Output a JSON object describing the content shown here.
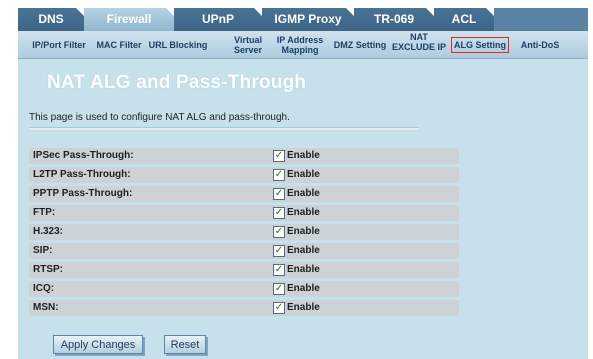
{
  "top_tabs": [
    {
      "label": "DNS",
      "active": false
    },
    {
      "label": "Firewall",
      "active": true
    },
    {
      "label": "UPnP",
      "active": false
    },
    {
      "label": "IGMP Proxy",
      "active": false
    },
    {
      "label": "TR-069",
      "active": false
    },
    {
      "label": "ACL",
      "active": false
    }
  ],
  "sub_nav": [
    {
      "label": "IP/Port Filter"
    },
    {
      "label": "MAC Filter"
    },
    {
      "label": "URL Blocking"
    },
    {
      "label": "Virtual Server"
    },
    {
      "label": "IP Address Mapping"
    },
    {
      "label": "DMZ Setting"
    },
    {
      "label": "NAT EXCLUDE IP"
    },
    {
      "label": "ALG Setting",
      "active": true
    },
    {
      "label": "Anti-DoS"
    }
  ],
  "page": {
    "title": "NAT ALG and Pass-Through",
    "description": "This page is used to configure NAT ALG and pass-through."
  },
  "options": [
    {
      "label": "IPSec Pass-Through:",
      "enabled": true,
      "enable_label": "Enable"
    },
    {
      "label": "L2TP Pass-Through:",
      "enabled": true,
      "enable_label": "Enable"
    },
    {
      "label": "PPTP Pass-Through:",
      "enabled": true,
      "enable_label": "Enable"
    },
    {
      "label": "FTP:",
      "enabled": true,
      "enable_label": "Enable"
    },
    {
      "label": "H.323:",
      "enabled": true,
      "enable_label": "Enable"
    },
    {
      "label": "SIP:",
      "enabled": true,
      "enable_label": "Enable"
    },
    {
      "label": "RTSP:",
      "enabled": true,
      "enable_label": "Enable"
    },
    {
      "label": "ICQ:",
      "enabled": true,
      "enable_label": "Enable"
    },
    {
      "label": "MSN:",
      "enabled": true,
      "enable_label": "Enable"
    }
  ],
  "buttons": {
    "apply": "Apply Changes",
    "reset": "Reset"
  },
  "colors": {
    "tab_bar": "#4a7295",
    "active_tab": "#9fc2d8",
    "content_bg": "#c6e0ec",
    "row_bg": "#ccd2d6",
    "active_sub_border": "#e0262e"
  }
}
